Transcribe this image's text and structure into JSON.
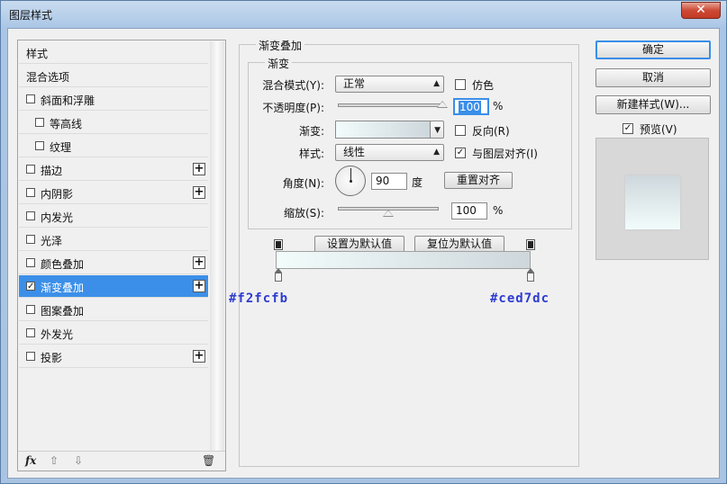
{
  "window": {
    "title": "图层样式",
    "close_label": "✕"
  },
  "styles_panel": {
    "items": [
      {
        "label": "样式",
        "has_checkbox": false,
        "checked": false,
        "has_plus": false,
        "selected": false,
        "indent": false
      },
      {
        "label": "混合选项",
        "has_checkbox": false,
        "checked": false,
        "has_plus": false,
        "selected": false,
        "indent": false
      },
      {
        "label": "斜面和浮雕",
        "has_checkbox": true,
        "checked": false,
        "has_plus": false,
        "selected": false,
        "indent": false
      },
      {
        "label": "等高线",
        "has_checkbox": true,
        "checked": false,
        "has_plus": false,
        "selected": false,
        "indent": true
      },
      {
        "label": "纹理",
        "has_checkbox": true,
        "checked": false,
        "has_plus": false,
        "selected": false,
        "indent": true
      },
      {
        "label": "描边",
        "has_checkbox": true,
        "checked": false,
        "has_plus": true,
        "selected": false,
        "indent": false
      },
      {
        "label": "内阴影",
        "has_checkbox": true,
        "checked": false,
        "has_plus": true,
        "selected": false,
        "indent": false
      },
      {
        "label": "内发光",
        "has_checkbox": true,
        "checked": false,
        "has_plus": false,
        "selected": false,
        "indent": false
      },
      {
        "label": "光泽",
        "has_checkbox": true,
        "checked": false,
        "has_plus": false,
        "selected": false,
        "indent": false
      },
      {
        "label": "颜色叠加",
        "has_checkbox": true,
        "checked": false,
        "has_plus": true,
        "selected": false,
        "indent": false
      },
      {
        "label": "渐变叠加",
        "has_checkbox": true,
        "checked": true,
        "has_plus": true,
        "selected": true,
        "indent": false
      },
      {
        "label": "图案叠加",
        "has_checkbox": true,
        "checked": false,
        "has_plus": false,
        "selected": false,
        "indent": false
      },
      {
        "label": "外发光",
        "has_checkbox": true,
        "checked": false,
        "has_plus": false,
        "selected": false,
        "indent": false
      },
      {
        "label": "投影",
        "has_checkbox": true,
        "checked": false,
        "has_plus": true,
        "selected": false,
        "indent": false
      }
    ],
    "bottom_icons": {
      "fx": "fx",
      "up": "⇧",
      "down": "⇩",
      "trash": "🗑"
    }
  },
  "gradient_overlay": {
    "group_title": "渐变叠加",
    "sub_title": "渐变",
    "blend_mode_label": "混合模式(Y):",
    "blend_mode_value": "正常",
    "dither_label": "仿色",
    "opacity_label": "不透明度(P):",
    "opacity_value": "100",
    "opacity_unit": "%",
    "opacity_level": 1.0,
    "gradient_label": "渐变:",
    "reverse_label": "反向(R)",
    "style_label": "样式:",
    "style_value": "线性",
    "align_label": "与图层对齐(I)",
    "align_checked": true,
    "angle_label": "角度(N):",
    "angle_value": "90",
    "angle_unit": "度",
    "reset_align_button": "重置对齐",
    "scale_label": "缩放(S):",
    "scale_value": "100",
    "scale_unit": "%",
    "scale_level": 0.5,
    "set_default_button": "设置为默认值",
    "reset_default_button": "复位为默认值"
  },
  "gradient_editor": {
    "start_color": "#f2fcfb",
    "end_color": "#ced7dc",
    "start_hex_label": "#f2fcfb",
    "end_hex_label": "#ced7dc",
    "label_color": "#2e3bd1"
  },
  "right_panel": {
    "ok_button": "确定",
    "cancel_button": "取消",
    "new_style_button": "新建样式(W)...",
    "preview_label": "预览(V)",
    "preview_checked": true
  },
  "colors": {
    "selection": "#3c8fe8",
    "accent_border": "#3a8ee8"
  }
}
